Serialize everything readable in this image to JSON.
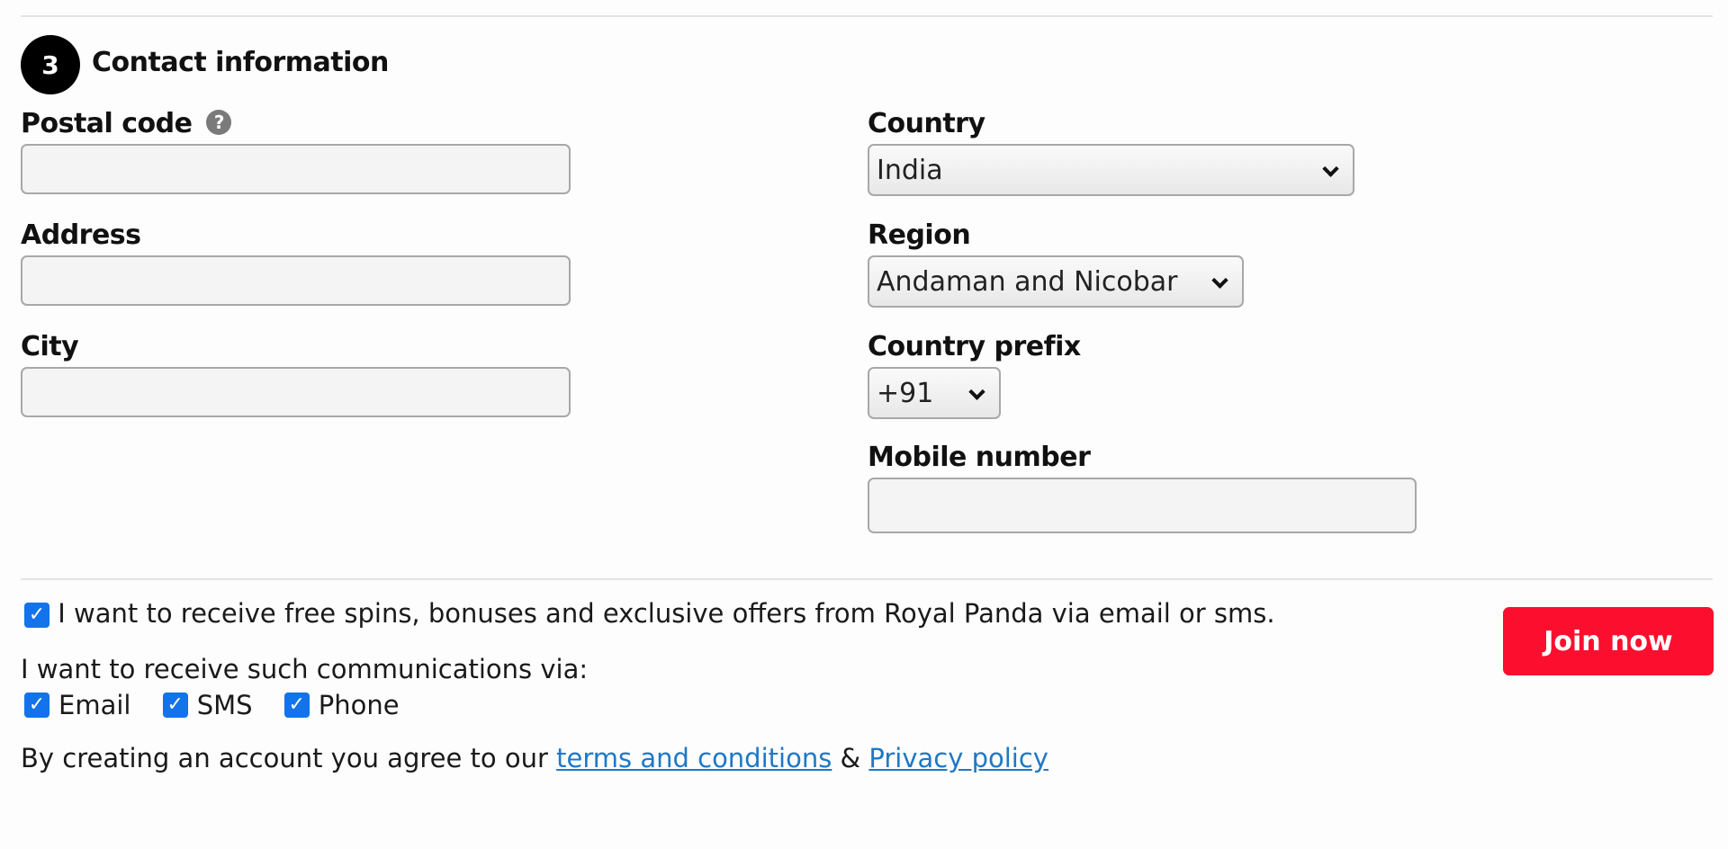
{
  "section": {
    "step_number": "3",
    "title": "Contact information"
  },
  "left_fields": [
    {
      "label": "Postal code",
      "value": "",
      "has_help": true
    },
    {
      "label": "Address",
      "value": ""
    },
    {
      "label": "City",
      "value": ""
    }
  ],
  "right_fields": {
    "country": {
      "label": "Country",
      "value": "India"
    },
    "region": {
      "label": "Region",
      "value": "Andaman and Nicobar"
    },
    "prefix": {
      "label": "Country prefix",
      "value": "+91"
    },
    "mobile": {
      "label": "Mobile number",
      "value": ""
    }
  },
  "help_icon": "?",
  "checkmark": "✓",
  "offers": {
    "checked": true,
    "label": "I want to receive free spins, bonuses and exclusive offers from Royal Panda via email or sms."
  },
  "communications": {
    "label": "I want to receive such communications via:",
    "options": [
      {
        "label": "Email",
        "checked": true
      },
      {
        "label": "SMS",
        "checked": true
      },
      {
        "label": "Phone",
        "checked": true
      }
    ]
  },
  "agreement": {
    "prefix": "By creating an account you agree to our ",
    "terms_link": "terms and conditions",
    "joiner": " & ",
    "privacy_link": "Privacy policy"
  },
  "join_button": "Join now",
  "colors": {
    "accent_red": "#fc0f2e",
    "checkbox_blue": "#1273eb",
    "link_blue": "#1f78c6"
  }
}
